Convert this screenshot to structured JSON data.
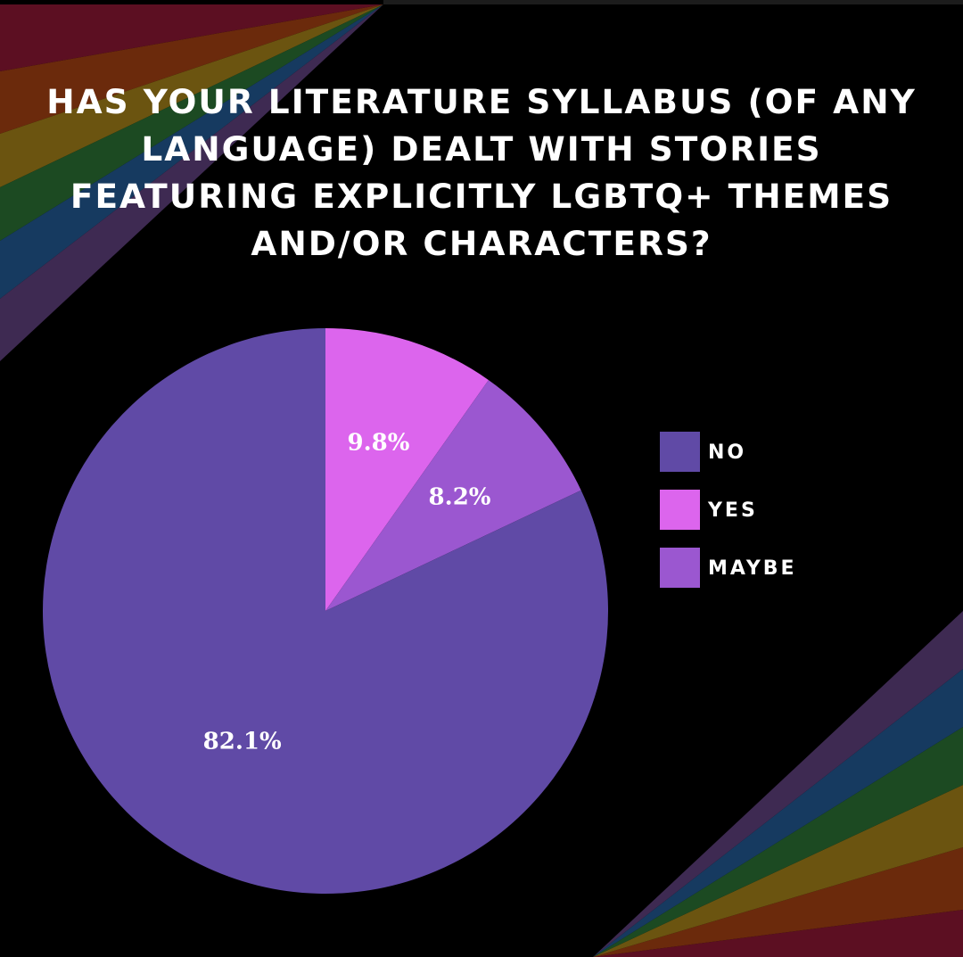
{
  "title_lines": [
    "HAS YOUR LITERATURE SYLLABUS (OF ANY",
    "LANGUAGE) DEALT WITH STORIES",
    "FEATURING EXPLICITLY LGBTQ+ THEMES",
    "AND/OR CHARACTERS?"
  ],
  "colors": {
    "background": "#000000",
    "rainbow": [
      "#5c0f22",
      "#6b2a0c",
      "#6b5410",
      "#1c4a22",
      "#163a60",
      "#3e2a52"
    ]
  },
  "chart_data": {
    "type": "pie",
    "title": "HAS YOUR LITERATURE SYLLABUS (OF ANY LANGUAGE) DEALT WITH STORIES FEATURING EXPLICITLY LGBTQ+ THEMES AND/OR CHARACTERS?",
    "start_angle": "12 o'clock",
    "direction": "clockwise",
    "legend_position": "right",
    "slices": [
      {
        "category": "YES",
        "value": 9.8,
        "label": "9.8%",
        "color": "#dc65ed"
      },
      {
        "category": "MAYBE",
        "value": 8.2,
        "label": "8.2%",
        "color": "#9b57d0"
      },
      {
        "category": "NO",
        "value": 82.1,
        "label": "82.1%",
        "color": "#604aa6"
      }
    ],
    "legend": [
      {
        "label": "NO",
        "color": "#604aa6"
      },
      {
        "label": "YES",
        "color": "#dc65ed"
      },
      {
        "label": "MAYBE",
        "color": "#9b57d0"
      }
    ]
  }
}
